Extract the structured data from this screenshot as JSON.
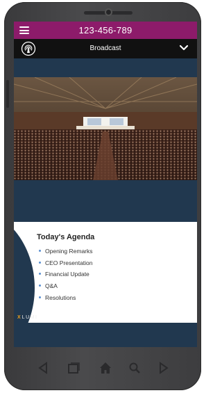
{
  "header": {
    "phone_number": "123-456-789"
  },
  "broadcast": {
    "label": "Broadcast",
    "icon": "broadcast-icon",
    "toggle_icon": "chevron-down-icon"
  },
  "slide": {
    "title": "Today's Agenda",
    "items": [
      "Opening Remarks",
      "CEO Presentation",
      "Financial Update",
      "Q&A",
      "Resolutions"
    ],
    "brand": "LUMI",
    "brand_mark": "X"
  },
  "colors": {
    "accent": "#8d1b6a",
    "background": "#21384f",
    "bar": "#111111",
    "brand_mark": "#f0a11b"
  },
  "navbar": [
    "back-icon",
    "recent-apps-icon",
    "home-icon",
    "search-icon",
    "forward-icon"
  ]
}
